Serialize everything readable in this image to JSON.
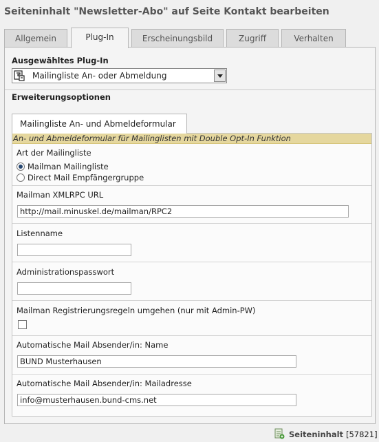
{
  "page": {
    "title": "Seiteninhalt \"Newsletter-Abo\" auf Seite Kontakt bearbeiten"
  },
  "tabs": [
    {
      "label": "Allgemein"
    },
    {
      "label": "Plug-In"
    },
    {
      "label": "Erscheinungsbild"
    },
    {
      "label": "Zugriff"
    },
    {
      "label": "Verhalten"
    }
  ],
  "plugin": {
    "section_label": "Ausgewähltes Plug-In",
    "selected": "Mailingliste An- oder Abmeldung"
  },
  "extension": {
    "section_label": "Erweiterungsoptionen",
    "subtab": "Mailingliste An- und Abmeldeformular",
    "description": "An- und Abmeldeformular für Mailinglisten mit Double Opt-In Funktion"
  },
  "form": {
    "list_type": {
      "label": "Art der Mailingliste",
      "options": [
        {
          "label": "Mailman Mailingliste",
          "checked": true
        },
        {
          "label": "Direct Mail Empfängergruppe",
          "checked": false
        }
      ]
    },
    "xmlrpc": {
      "label": "Mailman XMLRPC URL",
      "value": "http://mail.minuskel.de/mailman/RPC2"
    },
    "listname": {
      "label": "Listenname",
      "value": ""
    },
    "admin_password": {
      "label": "Administrationspasswort",
      "value": ""
    },
    "bypass_rules": {
      "label": "Mailman Registrierungsregeln umgehen (nur mit Admin-PW)",
      "checked": false
    },
    "sender_name": {
      "label": "Automatische Mail Absender/in: Name",
      "value": "BUND Musterhausen"
    },
    "sender_mail": {
      "label": "Automatische Mail Absender/in: Mailadresse",
      "value": "info@musterhausen.bund-cms.net"
    }
  },
  "footer": {
    "record_type": "Seiteninhalt",
    "record_id": "[57821]"
  },
  "colors": {
    "description_bg": "#e5d79e",
    "radio_selected": "#24456f"
  }
}
